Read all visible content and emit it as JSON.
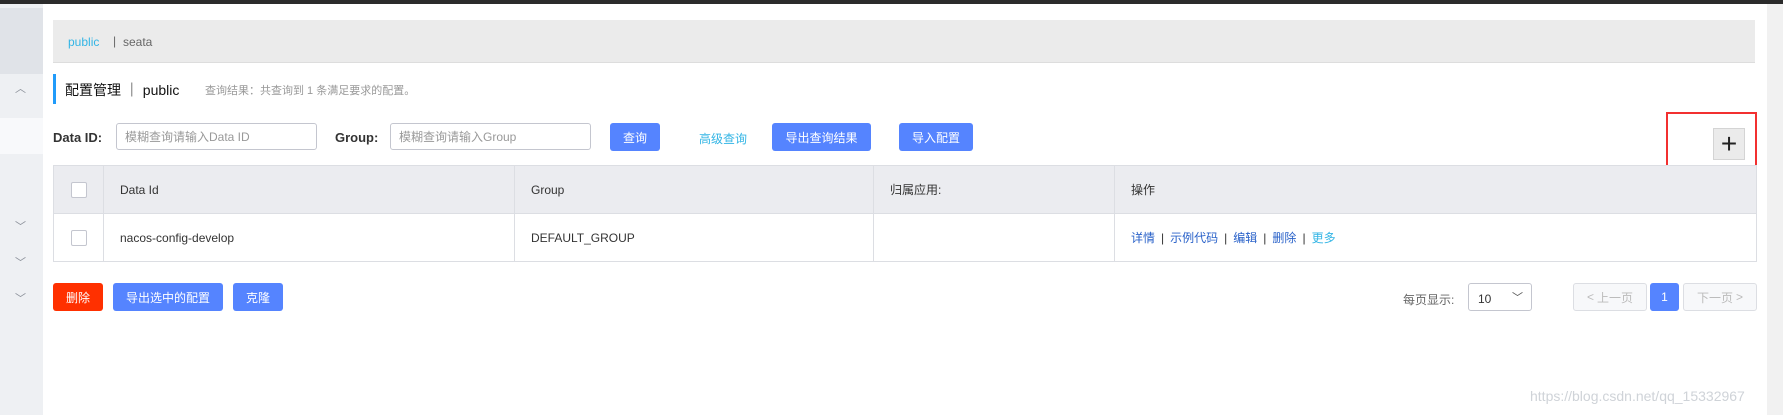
{
  "breadcrumb": {
    "namespace": "public",
    "separator": "|",
    "section": "seata"
  },
  "title": {
    "main": "配置管理 ｜ public",
    "hint": "查询结果：共查询到 1 条满足要求的配置。"
  },
  "search": {
    "data_id_label": "Data ID:",
    "data_id_placeholder": "模糊查询请输入Data ID",
    "group_label": "Group:",
    "group_placeholder": "模糊查询请输入Group",
    "query_button": "查询",
    "advanced_link": "高级查询",
    "export_results_button": "导出查询结果",
    "import_button": "导入配置"
  },
  "add_button": {
    "symbol": "+"
  },
  "table": {
    "headers": [
      "Data Id",
      "Group",
      "归属应用:",
      "操作"
    ],
    "rows": [
      {
        "data_id": "nacos-config-develop",
        "group": "DEFAULT_GROUP",
        "app": ""
      }
    ],
    "ops": {
      "detail": "详情",
      "sample": "示例代码",
      "edit": "编辑",
      "delete": "删除",
      "more": "更多",
      "sep": "|"
    }
  },
  "footer": {
    "delete_button": "删除",
    "export_selected_button": "导出选中的配置",
    "clone_button": "克隆",
    "page_size_label": "每页显示:",
    "page_size_value": "10",
    "prev_page": "上一页",
    "current_page": "1",
    "next_page": "下一页"
  },
  "watermark": "https://blog.csdn.net/qq_15332967",
  "colors": {
    "primary": "#5584ff",
    "danger": "#ff3000",
    "link": "#33b5e5",
    "highlight_box": "#f23030"
  },
  "icons": {
    "add": "plus-icon",
    "chevron_up": "chevron-up-icon",
    "chevron_down": "chevron-down-icon",
    "select_arrow": "chevron-down-icon"
  }
}
